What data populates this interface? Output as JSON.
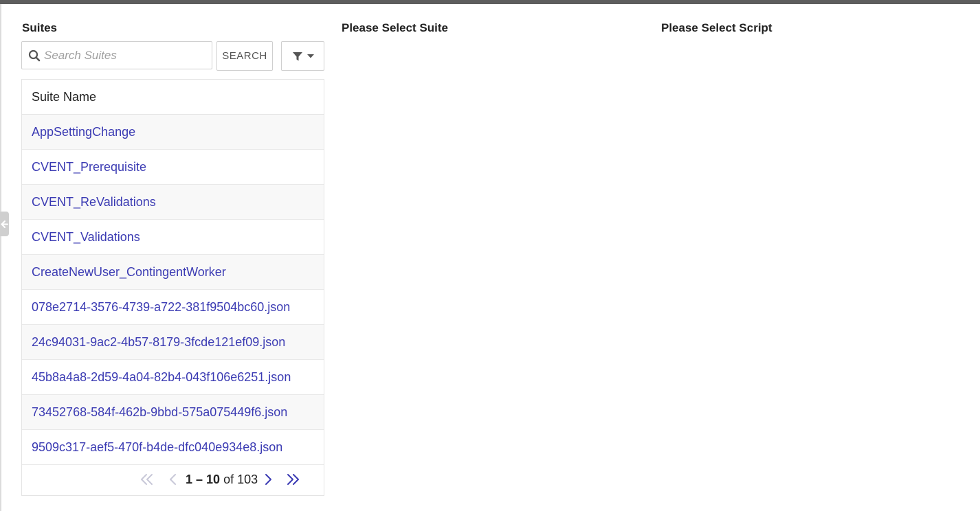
{
  "headings": {
    "suites": "Suites",
    "select_suite": "Please Select Suite",
    "select_script": "Please Select Script"
  },
  "search": {
    "placeholder": "Search Suites",
    "value": "",
    "button_label": "SEARCH"
  },
  "filter": {
    "icon": "filter-icon",
    "caret_icon": "caret-down-icon"
  },
  "table": {
    "column_header": "Suite Name",
    "rows": [
      "AppSettingChange",
      "CVENT_Prerequisite",
      "CVENT_ReValidations",
      "CVENT_Validations",
      "CreateNewUser_ContingentWorker",
      "078e2714-3576-4739-a722-381f9504bc60.json",
      "24c94031-9ac2-4b57-8179-3fcde121ef09.json",
      "45b8a4a8-2d59-4a04-82b4-043f106e6251.json",
      "73452768-584f-462b-9bbd-575a075449f6.json",
      "9509c317-aef5-470f-b4de-dfc040e934e8.json"
    ]
  },
  "pagination": {
    "range": "1 – 10",
    "of_label": "of",
    "total": "103",
    "icons": [
      "first-page-icon",
      "previous-page-icon",
      "next-page-icon",
      "last-page-icon"
    ]
  },
  "colors": {
    "link": "#3b3bb3",
    "topbar": "#5e5e5e",
    "disabled_icon": "#c8c8d8",
    "active_icon": "#3b3bb3"
  }
}
